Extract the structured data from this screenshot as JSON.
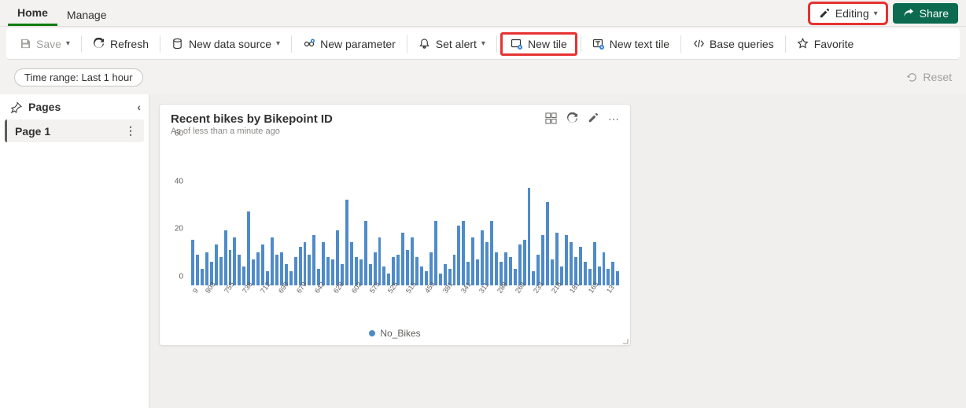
{
  "tabs": {
    "home": "Home",
    "manage": "Manage"
  },
  "editing": {
    "label": "Editing"
  },
  "share": {
    "label": "Share"
  },
  "toolbar": {
    "save": "Save",
    "refresh": "Refresh",
    "newDataSource": "New data source",
    "newParameter": "New parameter",
    "setAlert": "Set alert",
    "newTile": "New tile",
    "newTextTile": "New text tile",
    "baseQueries": "Base queries",
    "favorite": "Favorite"
  },
  "timeRange": {
    "label": "Time range: Last 1 hour"
  },
  "reset": {
    "label": "Reset"
  },
  "sidebar": {
    "header": "Pages",
    "pages": [
      {
        "label": "Page 1"
      }
    ]
  },
  "tile": {
    "title": "Recent bikes by Bikepoint ID",
    "subtitle": "As of less than a minute ago",
    "legend": "No_Bikes"
  },
  "chart_data": {
    "type": "bar",
    "title": "Recent bikes by Bikepoint ID",
    "xlabel": "",
    "ylabel": "",
    "ylim": [
      0,
      60
    ],
    "yticks": [
      0,
      20,
      40,
      60
    ],
    "series": [
      {
        "name": "No_Bikes",
        "categories": [
          "9",
          "",
          "803",
          "",
          "755",
          "",
          "738",
          "",
          "712",
          "",
          "690",
          "",
          "670",
          "",
          "642",
          "",
          "628",
          "",
          "602",
          "",
          "573",
          "",
          "525",
          "",
          "515",
          "",
          "459",
          "",
          "381",
          "",
          "341",
          "",
          "311",
          "",
          "288",
          "",
          "268",
          "",
          "233",
          "",
          "218",
          "",
          "181",
          "",
          "163",
          "",
          "13",
          ""
        ],
        "values": [
          19,
          13,
          7,
          14,
          10,
          17,
          12,
          23,
          15,
          20,
          13,
          8,
          31,
          11,
          14,
          17,
          6,
          20,
          13,
          14,
          9,
          6,
          12,
          16,
          18,
          13,
          21,
          7,
          18,
          12,
          11,
          23,
          9,
          36,
          18,
          12,
          11,
          27,
          9,
          14,
          20,
          8,
          5,
          12,
          13,
          22,
          15,
          20,
          12,
          8,
          6,
          14,
          27,
          5,
          9,
          7,
          13,
          25,
          27,
          10,
          20,
          11,
          23,
          18,
          27,
          14,
          10,
          14,
          12,
          7,
          17,
          19,
          41,
          6,
          13,
          21,
          35,
          11,
          22,
          8,
          21,
          18,
          12,
          16,
          10,
          7,
          18,
          8,
          14,
          7,
          10,
          6
        ]
      }
    ]
  }
}
